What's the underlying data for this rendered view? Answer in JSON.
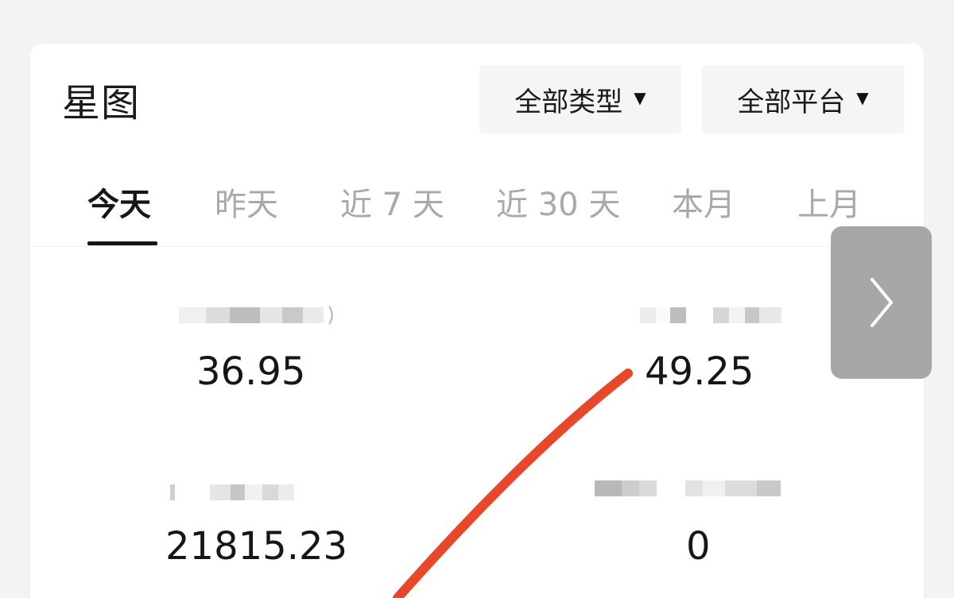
{
  "header": {
    "title": "星图",
    "type_filter": "全部类型",
    "platform_filter": "全部平台",
    "caret_icon": "caret-down-icon"
  },
  "tabs": [
    {
      "label": "今天",
      "active": true
    },
    {
      "label": "昨天",
      "active": false
    },
    {
      "label": "近 7 天",
      "active": false
    },
    {
      "label": "近 30 天",
      "active": false
    },
    {
      "label": "本月",
      "active": false
    },
    {
      "label": "上月",
      "active": false
    }
  ],
  "metrics": [
    {
      "label": "",
      "value": "36.95"
    },
    {
      "label": "",
      "value": "49.25"
    },
    {
      "label": "",
      "value": "21815.23"
    },
    {
      "label": "",
      "value": "0"
    }
  ],
  "next_icon": "chevron-right-icon",
  "colors": {
    "background": "#f3f3f3",
    "card": "#ffffff",
    "dropdown_bg": "#f5f5f5",
    "active_tab": "#161616",
    "inactive_tab": "#a9a9a9",
    "next_button": "#a7a7a7",
    "annotation_stroke": "#e8472a"
  }
}
